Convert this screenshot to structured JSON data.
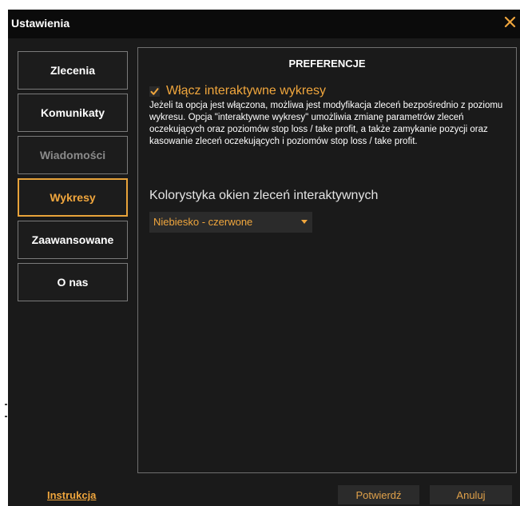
{
  "window": {
    "title": "Ustawienia",
    "close_icon": "close-icon",
    "accent_color": "#f0a63d"
  },
  "sidebar": {
    "items": [
      {
        "label": "Zlecenia",
        "state": "normal"
      },
      {
        "label": "Komunikaty",
        "state": "normal"
      },
      {
        "label": "Wiadomości",
        "state": "disabled"
      },
      {
        "label": "Wykresy",
        "state": "active"
      },
      {
        "label": "Zaawansowane",
        "state": "normal"
      },
      {
        "label": "O nas",
        "state": "normal"
      }
    ]
  },
  "panel": {
    "heading": "PREFERENCJE",
    "interactive_charts": {
      "label": "Włącz interaktywne wykresy",
      "checked": true,
      "description": "Jeżeli ta opcja jest włączona, możliwa jest modyfikacja zleceń bezpośrednio z poziomu wykresu. Opcja \"interaktywne wykresy\" umożliwia zmianę parametrów zleceń oczekujących oraz poziomów stop loss / take profit, a także zamykanie pozycji oraz kasowanie zleceń oczekujących i poziomów stop loss / take profit."
    },
    "color_scheme": {
      "label": "Kolorystyka okien zleceń interaktywnych",
      "selected": "Niebiesko - czerwone"
    }
  },
  "footer": {
    "help_link": "Instrukcja",
    "confirm_label": "Potwierdź",
    "cancel_label": "Anuluj"
  }
}
